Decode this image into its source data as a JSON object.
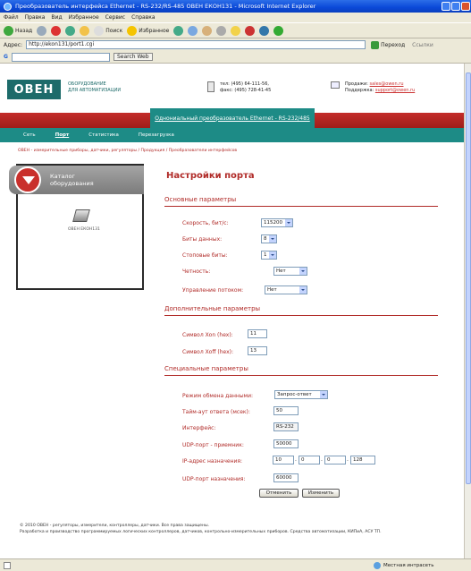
{
  "browser": {
    "title": "Преобразователь интерфейса Ethernet - RS-232/RS-485 ОВЕН ЕКОН131 - Microsoft Internet Explorer",
    "menu": [
      "Файл",
      "Правка",
      "Вид",
      "Избранное",
      "Сервис",
      "Справка"
    ],
    "back_label": "Назад",
    "search_label": "Поиск",
    "favorites_label": "Избранное",
    "address_label": "Адрес:",
    "address_value": "http://ekon131/port1.cgi",
    "go_label": "Переход",
    "links_label": "Ссылки",
    "search_web_label": "Search Web",
    "status_zone": "Местная интрасеть"
  },
  "header": {
    "logo": "ОВЕН",
    "tagline_line1": "ОБОРУДОВАНИЕ",
    "tagline_line2": "ДЛЯ АВТОМАТИЗАЦИИ",
    "phone_line1": "тел: (495) 64-111-56,",
    "phone_line2": "факс: (495) 728-41-45",
    "sales_label": "Продажи:",
    "sales_email": "sales@owen.ru",
    "support_label": "Поддержка:",
    "support_email": "support@owen.ru",
    "device_tab": "Однониальный преобразователь Ethernet - RS-232/485"
  },
  "nav": {
    "items": [
      "Сеть",
      "Порт",
      "Статистика",
      "Перезагрузка"
    ],
    "active_index": 1
  },
  "breadcrumb": "ОВЕН - измерительные приборы, датчики, регуляторы / Продукция / Преобразователи интерфейсов",
  "catalog": {
    "title_line1": "Каталог",
    "title_line2": "оборудования",
    "device_label": "ОВЕН ЕКОН131"
  },
  "form": {
    "title": "Настройки порта",
    "section_basic": "Основные параметры",
    "section_additional": "Дополнительные параметры",
    "section_special": "Специальные параметры",
    "speed_label": "Скорость, бит/с:",
    "speed_value": "115200",
    "databits_label": "Биты данных:",
    "databits_value": "8",
    "stopbits_label": "Стоповые биты:",
    "stopbits_value": "1",
    "parity_label": "Четность:",
    "parity_value": "Нет",
    "flow_label": "Управление потоком:",
    "flow_value": "Нет",
    "xon_label": "Символ Xon (hex):",
    "xon_value": "11",
    "xoff_label": "Символ Xoff (hex):",
    "xoff_value": "13",
    "mode_label": "Режим обмена данными:",
    "mode_value": "Запрос-ответ",
    "timeout_label": "Тайм-аут ответа (мсек):",
    "timeout_value": "50",
    "interface_label": "Интерфейс:",
    "interface_value": "RS-232",
    "udp_rx_label": "UDP-порт - приемник:",
    "udp_rx_value": "50000",
    "ip_label": "IP-адрес назначения:",
    "ip_octet1": "10",
    "ip_octet2": "0",
    "ip_octet3": "0",
    "ip_octet4": "128",
    "udp_dst_label": "UDP-порт назначения:",
    "udp_dst_value": "60000",
    "cancel_label": "Отменить",
    "apply_label": "Изменить"
  },
  "footer": {
    "line1": "© 2010 ОВЕН - регуляторы, измерители, контроллеры, датчики. Все права защищены.",
    "line2": "Разработка и производство программируемых логических контроллеров, датчиков, контрольно-измерительных приборов. Средства автоматизации, КИПиА, АСУ ТП."
  }
}
